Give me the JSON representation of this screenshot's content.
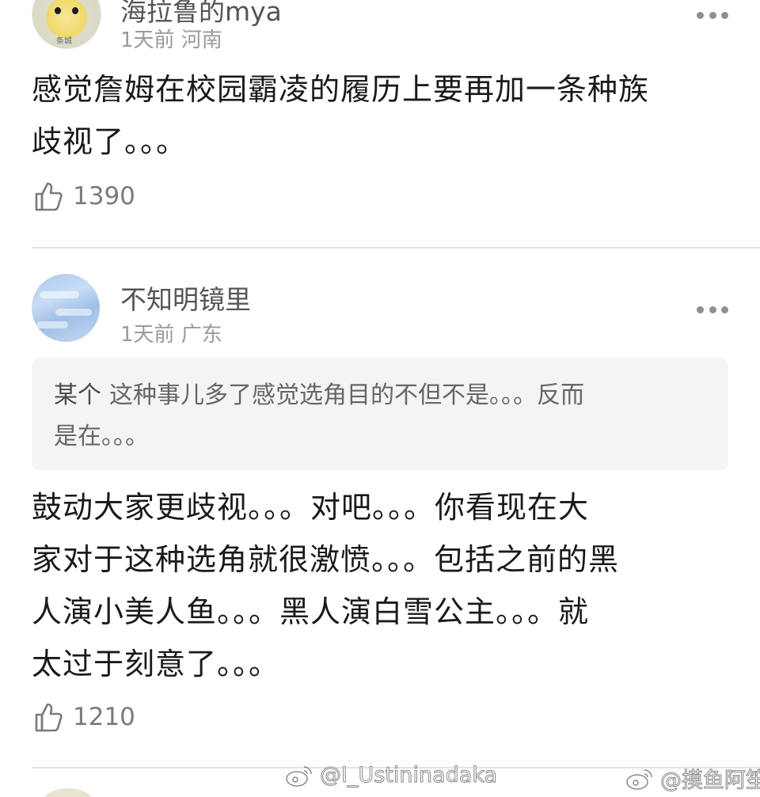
{
  "comments": [
    {
      "username": "海拉鲁的mya",
      "meta": "1天前 河南",
      "avatar_tag": "条城",
      "text_lines": [
        "感觉詹姆在校园霸凌的履历上要再加一条种族",
        "歧视了。。。"
      ],
      "likes": "1390"
    },
    {
      "username": "不知明镜里",
      "meta": "1天前 广东",
      "quote": {
        "user": "某个",
        "line1": "这种事儿多了感觉选角目的不但不是。。。反而",
        "line2": "是在。。。"
      },
      "text_lines": [
        "鼓动大家更歧视。。。对吧。。。你看现在大",
        "家对于这种选角就很激愤。。。包括之前的黑",
        "人演小美人鱼。。。黑人演白雪公主。。。就",
        "太过于刻意了。。。"
      ],
      "likes": "1210"
    }
  ],
  "watermarks": [
    "@I_Ustininadaka",
    "@摸鱼阿笙"
  ],
  "icons": {
    "more": "more-dots-icon",
    "like": "thumbs-up-icon",
    "weibo": "weibo-logo-icon"
  },
  "colors": {
    "text": "#1a1a1a",
    "meta": "#9a9a9a",
    "quote_bg": "#f4f4f4",
    "divider": "#e3e3e3"
  }
}
